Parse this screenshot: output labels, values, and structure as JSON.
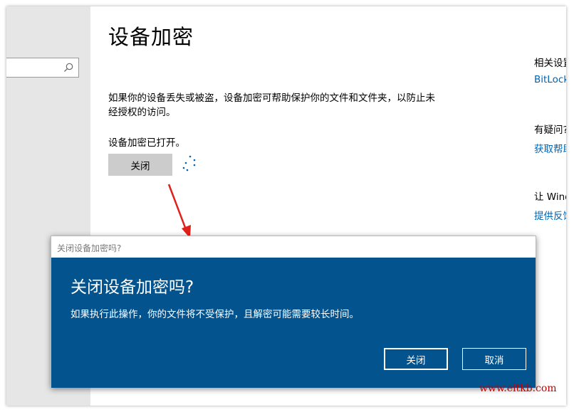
{
  "page": {
    "title": "设备加密",
    "description": "如果你的设备丢失或被盗，设备加密可帮助保护你的文件和文件夹，以防止未经授权的访问。",
    "status": "设备加密已打开。",
    "off_button": "关闭"
  },
  "search": {
    "icon": "search-icon",
    "value": ""
  },
  "related": {
    "heading1": "相关设置",
    "link1": "BitLocker",
    "heading2": "有疑问?",
    "link2": "获取帮助",
    "heading3": "让 Windows",
    "link3": "提供反馈"
  },
  "dialog": {
    "titlebar": "关闭设备加密吗?",
    "heading": "关闭设备加密吗?",
    "message": "如果执行此操作，你的文件将不受保护，且解密可能需要较长时间。",
    "confirm_label": "关闭",
    "cancel_label": "取消"
  },
  "watermark": "www.eitkb.com",
  "colors": {
    "accent": "#0063b1",
    "dialog_bg": "#03538f",
    "arrow": "#e0201b",
    "watermark": "#c00000"
  }
}
